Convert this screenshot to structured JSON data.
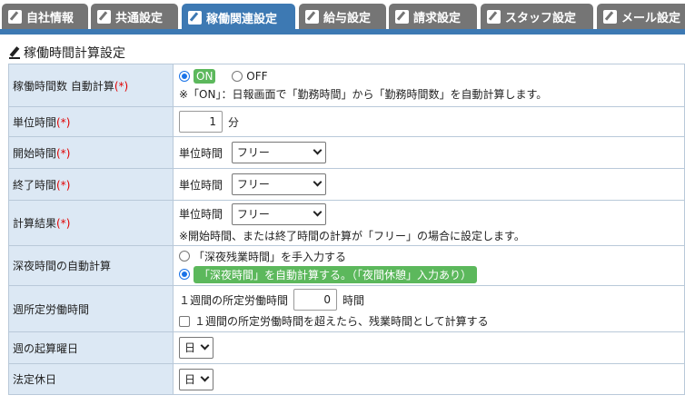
{
  "tabs": [
    {
      "label": "自社情報",
      "active": false
    },
    {
      "label": "共通設定",
      "active": false
    },
    {
      "label": "稼働関連設定",
      "active": true
    },
    {
      "label": "給与設定",
      "active": false
    },
    {
      "label": "請求設定",
      "active": false
    },
    {
      "label": "スタッフ設定",
      "active": false
    },
    {
      "label": "メール設定",
      "active": false
    }
  ],
  "section_title": "稼働時間計算設定",
  "required_mark": "(*)",
  "rows": {
    "auto_calc": {
      "label": "稼働時間数 自動計算",
      "on_label": "ON",
      "off_label": "OFF",
      "note": "※「ON」：日報画面で「勤務時間」から「勤務時間数」を自動計算します。"
    },
    "unit_time": {
      "label": "単位時間",
      "value": "1",
      "unit": "分"
    },
    "start_time": {
      "label": "開始時間",
      "inline_label": "単位時間",
      "selected": "フリー"
    },
    "end_time": {
      "label": "終了時間",
      "inline_label": "単位時間",
      "selected": "フリー"
    },
    "calc_result": {
      "label": "計算結果",
      "inline_label": "単位時間",
      "selected": "フリー",
      "note": "※開始時間、または終了時間の計算が「フリー」の場合に設定します。"
    },
    "night_auto": {
      "label": "深夜時間の自動計算",
      "option1": "「深夜残業時間」を手入力する",
      "option2": "「深夜時間」を自動計算する。（「夜間休憩」入力あり）"
    },
    "weekly_hours": {
      "label": "週所定労働時間",
      "inline_label": "１週間の所定労働時間",
      "value": "0",
      "unit": "時間",
      "checkbox_label": "１週間の所定労働時間を超えたら、残業時間として計算する"
    },
    "week_start": {
      "label": "週の起算曜日",
      "selected": "日"
    },
    "legal_holiday": {
      "label": "法定休日",
      "selected": "日"
    }
  }
}
